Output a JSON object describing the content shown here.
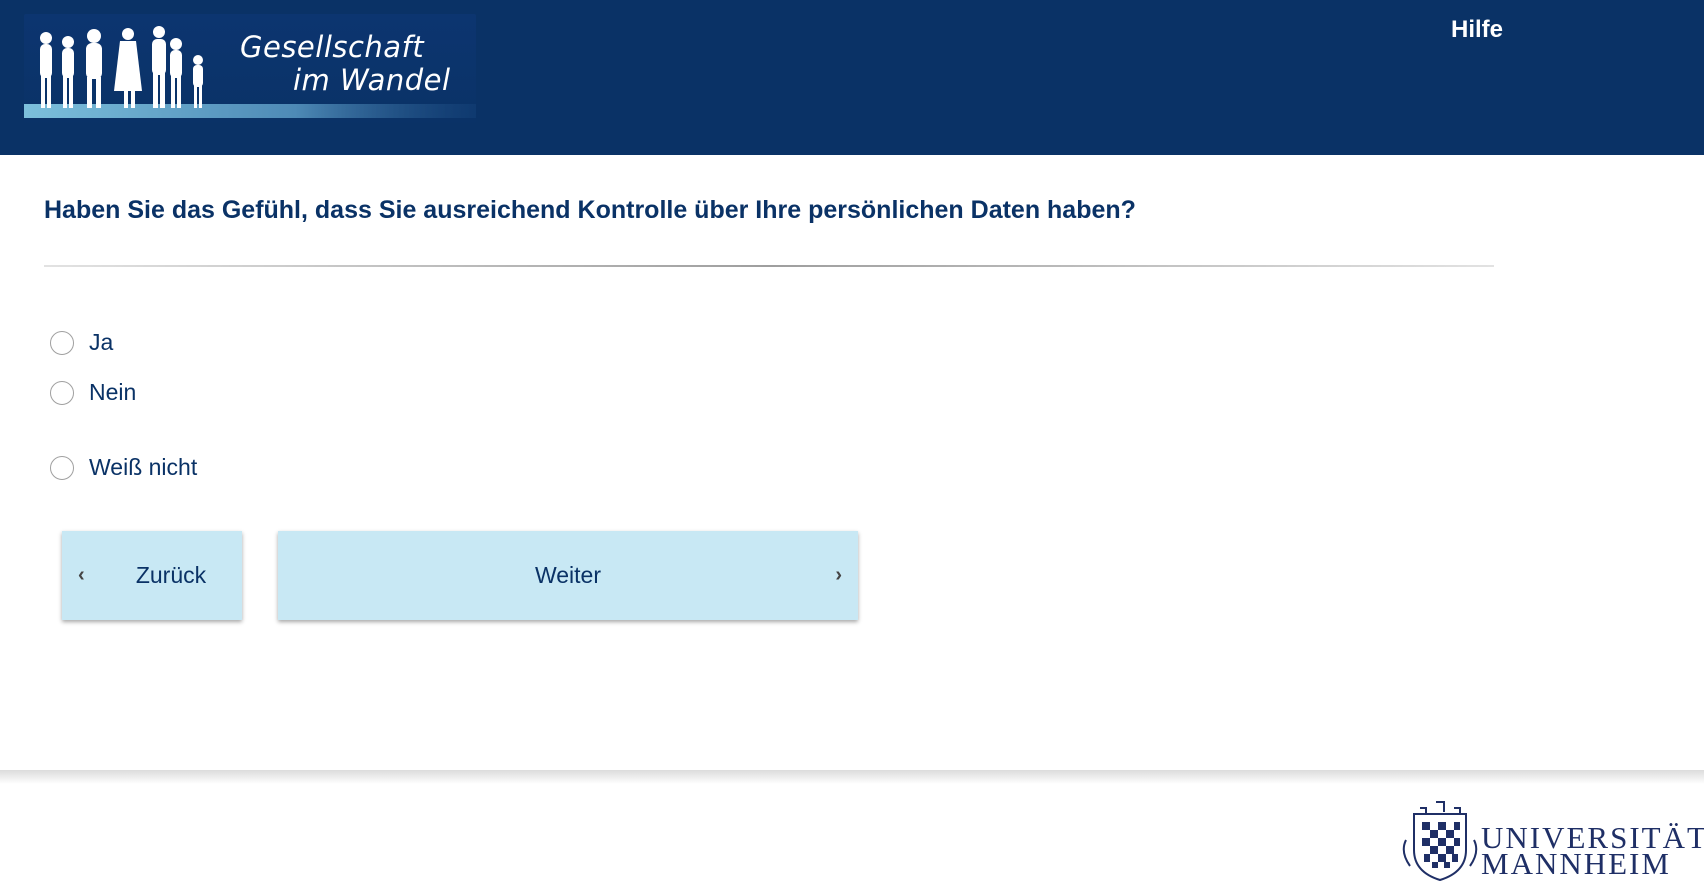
{
  "header": {
    "logo_line1": "Gesellschaft",
    "logo_line2": "im Wandel",
    "help_label": "Hilfe"
  },
  "question": {
    "text": "Haben Sie das Gefühl, dass Sie ausreichend Kontrolle über Ihre persönlichen Daten haben?",
    "options": [
      {
        "label": "Ja",
        "selected": false
      },
      {
        "label": "Nein",
        "selected": false
      },
      {
        "label": "Weiß nicht",
        "selected": false
      }
    ]
  },
  "nav": {
    "back_label": "Zurück",
    "next_label": "Weiter"
  },
  "footer": {
    "uni_line1": "UNIVERSITÄT",
    "uni_line2": "MANNHEIM"
  },
  "colors": {
    "header_bg": "#0a3266",
    "text_primary": "#0a3266",
    "button_bg": "#c8e8f4",
    "uni_brand": "#1f2f66"
  },
  "icons": {
    "back": "chevron-left-icon",
    "next": "chevron-right-icon",
    "logo_figures": "people-silhouettes-icon",
    "uni_crest": "crest-icon"
  }
}
